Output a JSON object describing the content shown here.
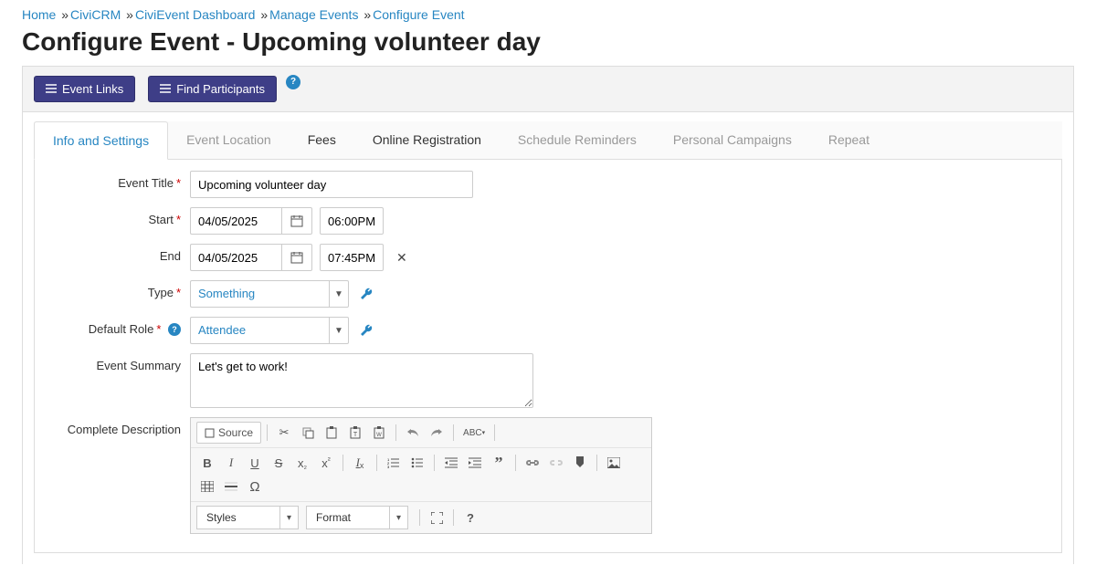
{
  "breadcrumb": {
    "home": "Home",
    "civicrm": "CiviCRM",
    "dashboard": "CiviEvent Dashboard",
    "manage": "Manage Events",
    "current": "Configure Event",
    "sep": "»"
  },
  "page_title": "Configure Event - Upcoming volunteer day",
  "actions": {
    "event_links": "Event Links",
    "find_participants": "Find Participants",
    "help": "?"
  },
  "tabs": [
    {
      "label": "Info and Settings",
      "state": "active"
    },
    {
      "label": "Event Location",
      "state": "inactive"
    },
    {
      "label": "Fees",
      "state": "dark"
    },
    {
      "label": "Online Registration",
      "state": "dark"
    },
    {
      "label": "Schedule Reminders",
      "state": "inactive"
    },
    {
      "label": "Personal Campaigns",
      "state": "inactive"
    },
    {
      "label": "Repeat",
      "state": "inactive"
    }
  ],
  "form": {
    "title_label": "Event Title",
    "title_value": "Upcoming volunteer day",
    "start_label": "Start",
    "start_date": "04/05/2025",
    "start_time": "06:00PM",
    "end_label": "End",
    "end_date": "04/05/2025",
    "end_time": "07:45PM",
    "type_label": "Type",
    "type_value": "Something",
    "role_label": "Default Role",
    "role_value": "Attendee",
    "summary_label": "Event Summary",
    "summary_value": "Let's get to work!",
    "desc_label": "Complete Description"
  },
  "rte": {
    "source": "Source",
    "abc": "ABC",
    "styles": "Styles",
    "format": "Format",
    "help": "?"
  }
}
